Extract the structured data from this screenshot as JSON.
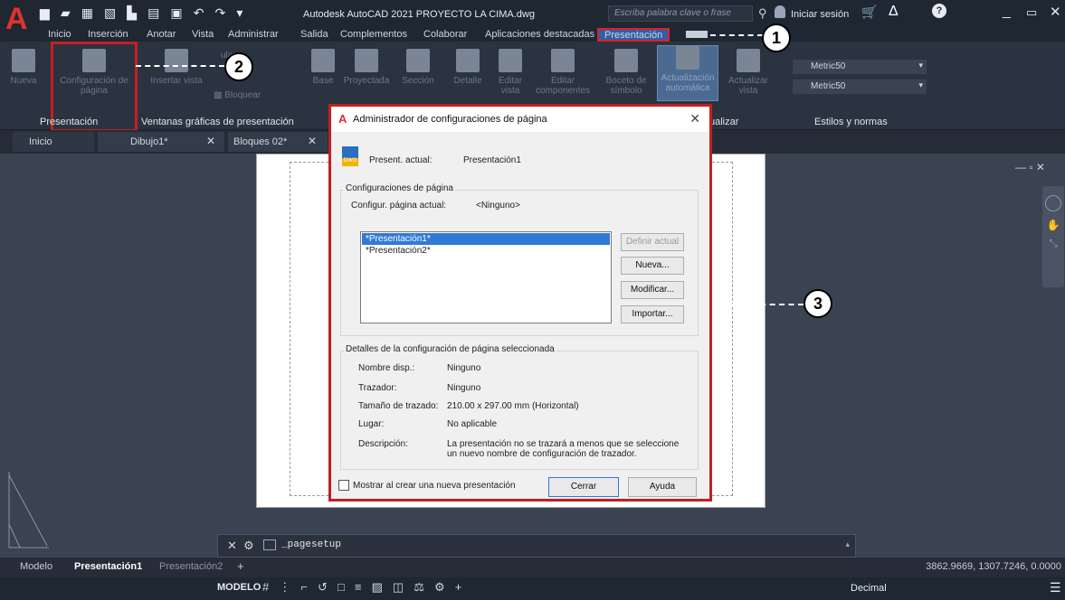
{
  "app": {
    "title": "Autodesk AutoCAD 2021   PROYECTO LA CIMA.dwg",
    "search_placeholder": "Escriba palabra clave o frase",
    "signin": "Iniciar sesión"
  },
  "menu": [
    "Inicio",
    "Inserción",
    "Anotar",
    "Vista",
    "Administrar",
    "Salida",
    "Complementos",
    "Colaborar",
    "Aplicaciones destacadas",
    "Presentación"
  ],
  "ribbon": {
    "buttons": [
      {
        "label": "Nueva"
      },
      {
        "label": "Configuración de página"
      },
      {
        "label": "Insertar vista"
      },
      {
        "label": "Bloquear"
      },
      {
        "label": "Base"
      },
      {
        "label": "Proyectada"
      },
      {
        "label": "Sección"
      },
      {
        "label": "Detalle"
      },
      {
        "label": "Editar vista"
      },
      {
        "label": "Editar componentes"
      },
      {
        "label": "Boceto de símbolo"
      },
      {
        "label": "Actualización automática"
      },
      {
        "label": "Actualizar vista"
      }
    ],
    "panels": [
      "Presentación",
      "Ventanas gráficas de presentación",
      "Estilos y normas"
    ],
    "panel_partial": "ualizar",
    "style_select_1": "Metric50",
    "style_select_2": "Metric50",
    "partial_label": "ular"
  },
  "doc_tabs": [
    "Inicio",
    "Dibujo1*",
    "Bloques 02*"
  ],
  "callouts": [
    "1",
    "2",
    "3"
  ],
  "dialog": {
    "title": "Administrador de configuraciones de página",
    "current_layout_label": "Present. actual:",
    "current_layout_value": "Presentación1",
    "group1_title": "Configuraciones de página",
    "current_setup_label": "Configur. página actual:",
    "current_setup_value": "<Ninguno>",
    "list_items": [
      "*Presentación1*",
      "*Presentación2*"
    ],
    "btn_set_current": "Definir actual",
    "btn_new": "Nueva...",
    "btn_modify": "Modificar...",
    "btn_import": "Importar...",
    "group2_title": "Detalles de la configuración de página seleccionada",
    "details": [
      {
        "label": "Nombre disp.:",
        "value": "Ninguno"
      },
      {
        "label": "Trazador:",
        "value": "Ninguno"
      },
      {
        "label": "Tamaño de trazado:",
        "value": "210.00 x 297.00 mm (Horizontal)"
      },
      {
        "label": "Lugar:",
        "value": "No aplicable"
      },
      {
        "label": "Descripción:",
        "value": "La presentación no se trazará a menos que se seleccione un nuevo nombre de configuración de trazador."
      }
    ],
    "checkbox_label": "Mostrar al crear una nueva presentación",
    "btn_close": "Cerrar",
    "btn_help": "Ayuda"
  },
  "command": "_pagesetup",
  "layout_tabs": [
    "Modelo",
    "Presentación1",
    "Presentación2"
  ],
  "coords": "3862.9669, 1307.7246, 0.0000",
  "status": {
    "model": "MODELO",
    "units": "Decimal"
  },
  "colors": {
    "accent_red": "#c41f1f",
    "selection_blue": "#3079d6",
    "app_dark": "#1f2733"
  }
}
